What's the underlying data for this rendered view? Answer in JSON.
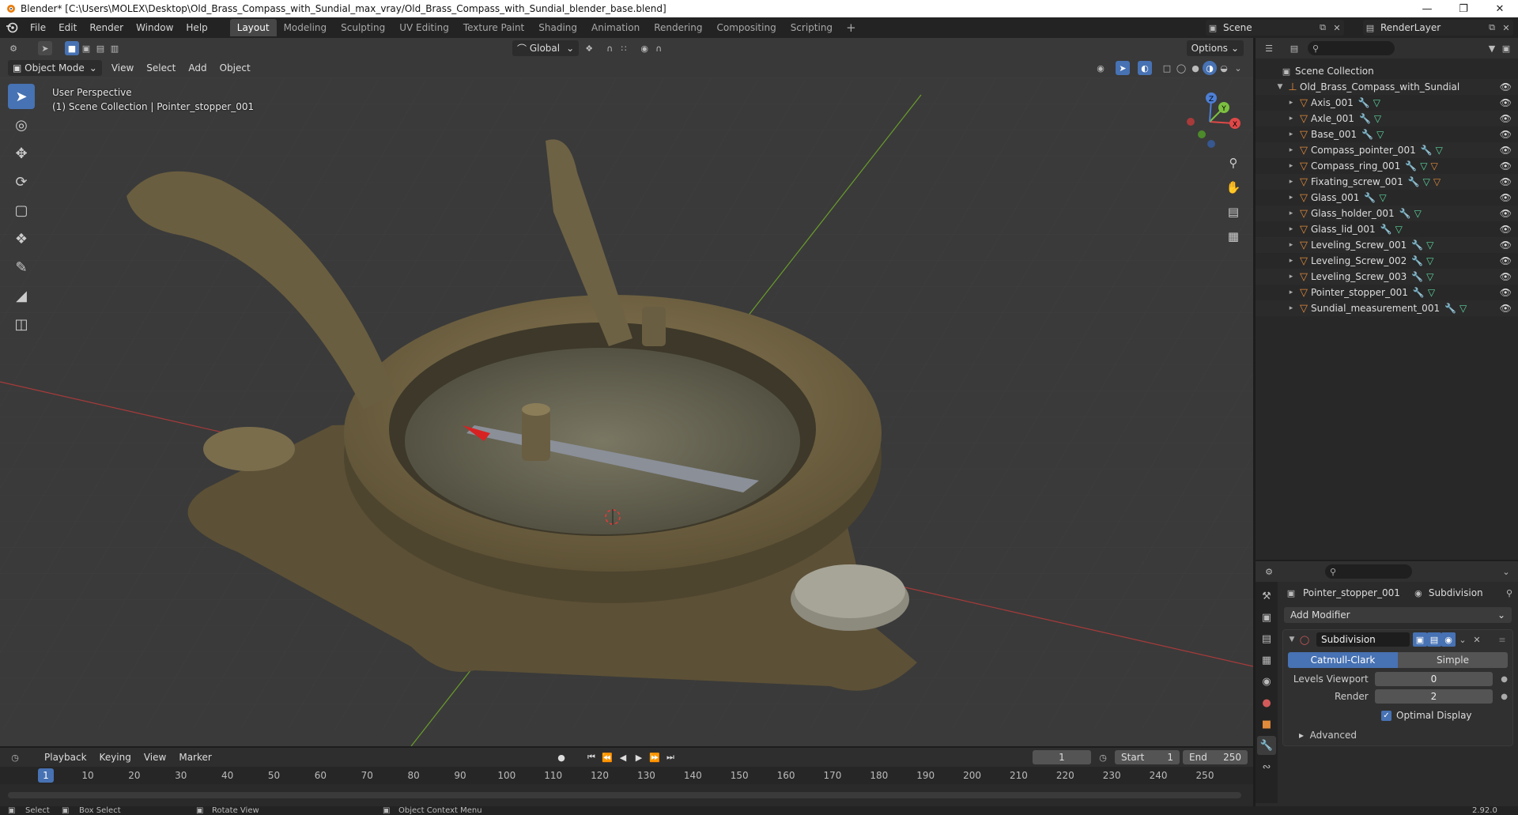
{
  "window": {
    "title": "Blender* [C:\\Users\\MOLEX\\Desktop\\Old_Brass_Compass_with_Sundial_max_vray/Old_Brass_Compass_with_Sundial_blender_base.blend]"
  },
  "menus": [
    "File",
    "Edit",
    "Render",
    "Window",
    "Help"
  ],
  "workspaces": [
    "Layout",
    "Modeling",
    "Sculpting",
    "UV Editing",
    "Texture Paint",
    "Shading",
    "Animation",
    "Rendering",
    "Compositing",
    "Scripting"
  ],
  "active_workspace": "Layout",
  "scene": {
    "label": "Scene",
    "render_layer": "RenderLayer"
  },
  "viewport": {
    "transform_orientation": "Global",
    "options_label": "Options",
    "mode": "Object Mode",
    "menus": [
      "View",
      "Select",
      "Add",
      "Object"
    ],
    "info_line1": "User Perspective",
    "info_line2": "(1) Scene Collection | Pointer_stopper_001",
    "gizmo": {
      "x": "X",
      "y": "Y",
      "z": "Z"
    }
  },
  "outliner": {
    "root": "Scene Collection",
    "collection": "Old_Brass_Compass_with_Sundial",
    "objects": [
      {
        "name": "Axis_001",
        "mat": false
      },
      {
        "name": "Axle_001",
        "mat": false
      },
      {
        "name": "Base_001",
        "mat": false
      },
      {
        "name": "Compass_pointer_001",
        "mat": false
      },
      {
        "name": "Compass_ring_001",
        "mat": true
      },
      {
        "name": "Fixating_screw_001",
        "mat": true
      },
      {
        "name": "Glass_001",
        "mat": false
      },
      {
        "name": "Glass_holder_001",
        "mat": false
      },
      {
        "name": "Glass_lid_001",
        "mat": false
      },
      {
        "name": "Leveling_Screw_001",
        "mat": false
      },
      {
        "name": "Leveling_Screw_002",
        "mat": false
      },
      {
        "name": "Leveling_Screw_003",
        "mat": false
      },
      {
        "name": "Pointer_stopper_001",
        "mat": false
      },
      {
        "name": "Sundial_measurement_001",
        "mat": false
      }
    ]
  },
  "properties": {
    "object": "Pointer_stopper_001",
    "modifier_ref": "Subdivision",
    "add_modifier": "Add Modifier",
    "modifier": {
      "name": "Subdivision",
      "type_a": "Catmull-Clark",
      "type_b": "Simple",
      "levels_viewport_label": "Levels Viewport",
      "levels_viewport": "0",
      "render_label": "Render",
      "render": "2",
      "optimal_display": "Optimal Display",
      "advanced": "Advanced"
    }
  },
  "timeline": {
    "menus": [
      "Playback",
      "Keying",
      "View",
      "Marker"
    ],
    "current_frame": "1",
    "start_label": "Start",
    "start": "1",
    "end_label": "End",
    "end": "250",
    "ticks": [
      "1",
      "10",
      "20",
      "30",
      "40",
      "50",
      "60",
      "70",
      "80",
      "90",
      "100",
      "110",
      "120",
      "130",
      "140",
      "150",
      "160",
      "170",
      "180",
      "190",
      "200",
      "210",
      "220",
      "230",
      "240",
      "250"
    ]
  },
  "statusbar": {
    "select": "Select",
    "box_select": "Box Select",
    "rotate_view": "Rotate View",
    "context_menu": "Object Context Menu",
    "version": "2.92.0"
  }
}
